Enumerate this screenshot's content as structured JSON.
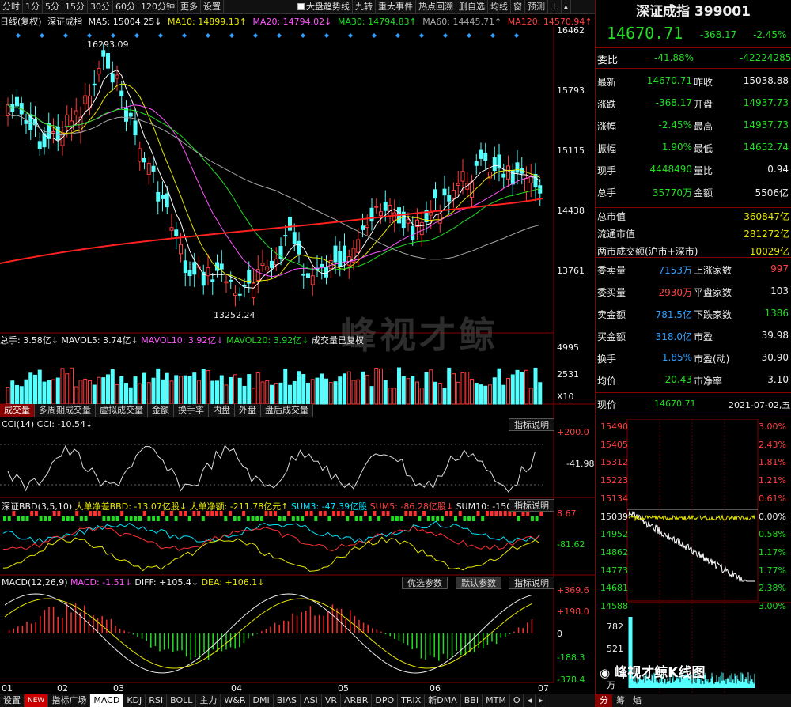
{
  "toolbar": {
    "tabs": [
      "分时",
      "1分",
      "5分",
      "15分",
      "30分",
      "60分",
      "120分钟",
      "更多",
      "设置"
    ],
    "options": [
      "大盘趋势线",
      "九转",
      "重大事件",
      "热点回溯",
      "删自选",
      "均线",
      "窗",
      "预测"
    ],
    "active_tab": "日线"
  },
  "legend": {
    "period": "日线(复权)",
    "name": "深证成指",
    "ma5": "MA5: 15004.25↓",
    "ma10": "MA10: 14899.13↑",
    "ma20": "MA20: 14794.02↓",
    "ma30": "MA30: 14794.83↑",
    "ma60": "MA60: 14445.71↑",
    "ma120": "MA120: 14570.94↑"
  },
  "price_axis": [
    "16462",
    "15793",
    "15115",
    "14438",
    "13761"
  ],
  "annotations": {
    "high": "16293.09",
    "low": "13252.24"
  },
  "volume": {
    "legend": [
      "总手: 3.58亿↓",
      "MAVOL5: 3.74亿↓",
      "MAVOL10: 3.92亿↓",
      "MAVOL20: 3.92亿↓",
      "成交量已复权"
    ],
    "axis": [
      "4995",
      "2531",
      "X10"
    ]
  },
  "vol_tabs": [
    "成交量",
    "多周期成交量",
    "虚拟成交量",
    "金额",
    "换手率",
    "内盘",
    "外盘",
    "盘后成交量"
  ],
  "cci": {
    "legend": "CCI(14) CCI: -10.54↓",
    "axis": [
      "+200.0",
      "-41.98"
    ],
    "help": "指标说明"
  },
  "bbd": {
    "legend": [
      "深证BBD(3,5,10)",
      "大单净差BBD: -13.07亿股↓",
      "大单净额: -211.78亿元↑",
      "SUM3: -47.39亿股",
      "SUM5: -86.28亿股↓",
      "SUM10: -150.66亿股"
    ],
    "axis": [
      "8.67",
      "-81.62"
    ],
    "help": "指标说明"
  },
  "macd": {
    "legend": [
      "MACD(12,26,9)",
      "MACD: -1.51↓",
      "DIFF: +105.4↓",
      "DEA: +106.1↓"
    ],
    "axis": [
      "+369.6",
      "+198.0",
      "0",
      "-188.3",
      "-378.4"
    ],
    "buttons": [
      "优选参数",
      "默认参数",
      "指标说明"
    ]
  },
  "x_axis": [
    "01",
    "02",
    "03",
    "04",
    "05",
    "06",
    "07"
  ],
  "bottom_tabs": [
    "设置",
    "NEW",
    "指标广场",
    "MACD",
    "KDJ",
    "RSI",
    "BOLL",
    "主力",
    "W&R",
    "DMI",
    "BIAS",
    "ASI",
    "VR",
    "ARBR",
    "DPO",
    "TRIX",
    "新DMA",
    "BBI",
    "MTM",
    "O"
  ],
  "watermark": "峰视才鲸",
  "watermark2": "峰视才鲸K线图",
  "quote": {
    "title": "深证成指 399001",
    "price": "14670.71",
    "change": "-368.17",
    "pct": "-2.45%",
    "weibi_label": "委比",
    "weibi": "-41.88%",
    "weicha": "-42224285",
    "rows": [
      [
        "最新",
        "14670.71",
        "昨收",
        "15038.88"
      ],
      [
        "涨跌",
        "-368.17",
        "开盘",
        "14937.73"
      ],
      [
        "涨幅",
        "-2.45%",
        "最高",
        "14937.73"
      ],
      [
        "振幅",
        "1.90%",
        "最低",
        "14652.74"
      ],
      [
        "现手",
        "4448490",
        "量比",
        "0.94"
      ],
      [
        "总手",
        "35770万",
        "金额",
        "5506亿"
      ]
    ],
    "mv_rows": [
      [
        "总市值",
        "360847亿"
      ],
      [
        "流通市值",
        "281272亿"
      ],
      [
        "两市成交额(沪市+深市)",
        "10029亿"
      ]
    ],
    "stats": [
      [
        "委卖量",
        "7153万",
        "上涨家数",
        "997"
      ],
      [
        "委买量",
        "2930万",
        "平盘家数",
        "103"
      ],
      [
        "卖金额",
        "781.5亿",
        "下跌家数",
        "1386"
      ],
      [
        "买金额",
        "318.0亿",
        "市盈",
        "39.98"
      ],
      [
        "换手",
        "1.85%",
        "市盈(动)",
        "30.90"
      ],
      [
        "均价",
        "20.43",
        "市净率",
        "3.10"
      ]
    ],
    "footer": {
      "label": "现价",
      "price": "14670.71",
      "date": "2021-07-02,五"
    }
  },
  "mini": {
    "left_axis": [
      "15490",
      "15405",
      "15312",
      "15223",
      "15134",
      "15039",
      "14952",
      "14862",
      "14773",
      "14681",
      "14588"
    ],
    "right_axis": [
      "3.00%",
      "2.43%",
      "1.81%",
      "1.21%",
      "0.61%",
      "0.00%",
      "0.58%",
      "1.17%",
      "1.77%",
      "2.38%",
      "3.00%"
    ],
    "vol_axis": [
      "782",
      "521",
      "万"
    ],
    "tabs": [
      "分",
      "筹",
      "焰"
    ]
  }
}
